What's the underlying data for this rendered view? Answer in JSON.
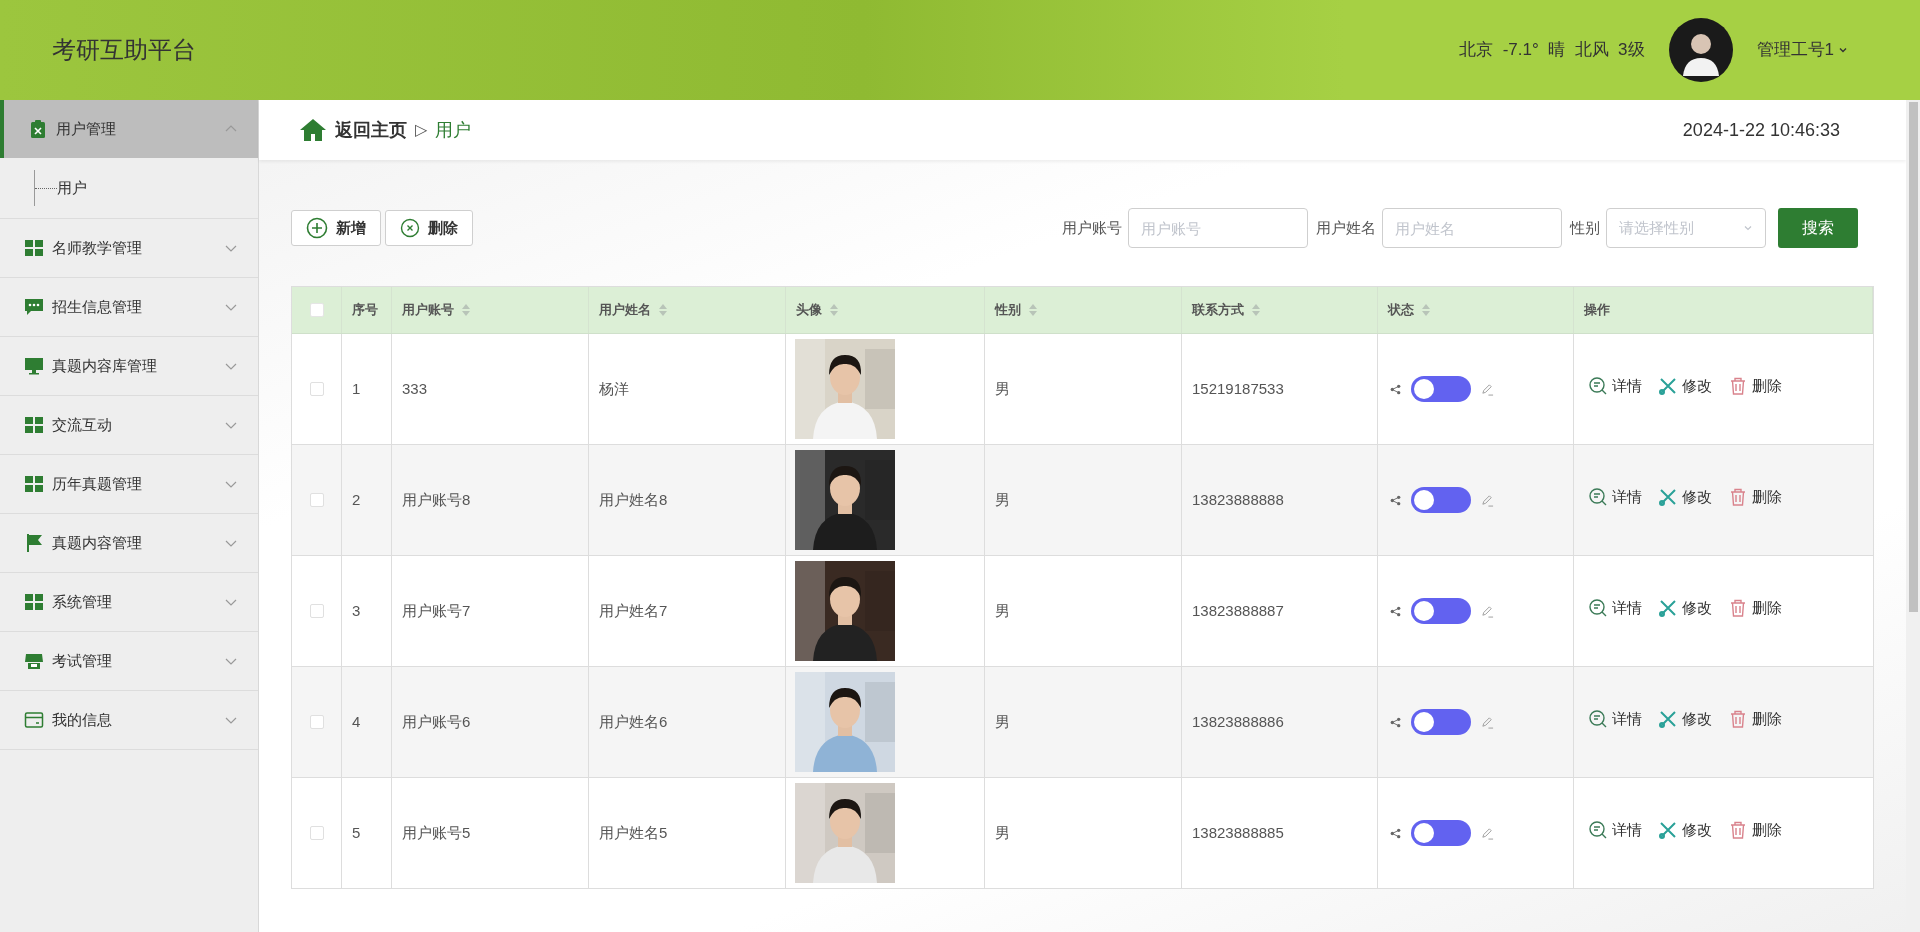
{
  "header": {
    "title": "考研互助平台",
    "weather": "北京  -7.1°  晴  北风  3级",
    "user": "管理工号1"
  },
  "sidebar": {
    "items": [
      {
        "label": "用户管理",
        "kind": "clipboard",
        "expanded": true,
        "selected": true,
        "children": [
          {
            "label": "用户"
          }
        ]
      },
      {
        "label": "名师教学管理",
        "kind": "grid",
        "expanded": false,
        "selected": false
      },
      {
        "label": "招生信息管理",
        "kind": "chat",
        "expanded": false,
        "selected": false
      },
      {
        "label": "真题内容库管理",
        "kind": "monitor",
        "expanded": false,
        "selected": false
      },
      {
        "label": "交流互动",
        "kind": "grid",
        "expanded": false,
        "selected": false
      },
      {
        "label": "历年真题管理",
        "kind": "grid",
        "expanded": false,
        "selected": false
      },
      {
        "label": "真题内容管理",
        "kind": "flag",
        "expanded": false,
        "selected": false
      },
      {
        "label": "系统管理",
        "kind": "grid",
        "expanded": false,
        "selected": false
      },
      {
        "label": "考试管理",
        "kind": "shop",
        "expanded": false,
        "selected": false
      },
      {
        "label": "我的信息",
        "kind": "card",
        "expanded": false,
        "selected": false
      }
    ]
  },
  "breadcrumb": {
    "home": "返回主页",
    "separator": "▷",
    "current": "用户"
  },
  "datetime": "2024-1-22 10:46:33",
  "toolbar": {
    "buttons": [
      {
        "label": "新增",
        "kind": "add"
      },
      {
        "label": "删除",
        "kind": "remove"
      }
    ],
    "filters": [
      {
        "label": "用户账号",
        "placeholder": "用户账号",
        "kind": "text"
      },
      {
        "label": "用户姓名",
        "placeholder": "用户姓名",
        "kind": "text"
      },
      {
        "label": "性别",
        "placeholder": "请选择性别",
        "kind": "select"
      }
    ],
    "search": "搜索"
  },
  "table": {
    "select_all_checked": false,
    "columns": [
      {
        "label": "序号",
        "sortable": false
      },
      {
        "label": "用户账号",
        "sortable": true
      },
      {
        "label": "用户姓名",
        "sortable": true
      },
      {
        "label": "头像",
        "sortable": true
      },
      {
        "label": "性别",
        "sortable": true
      },
      {
        "label": "联系方式",
        "sortable": true
      },
      {
        "label": "状态",
        "sortable": true
      },
      {
        "label": "操作",
        "sortable": false
      }
    ],
    "rows": [
      {
        "index": "1",
        "account": "333",
        "name": "杨洋",
        "gender": "男",
        "phone": "15219187533",
        "on": false,
        "checked": false,
        "actions": [
          "详情",
          "修改",
          "删除"
        ]
      },
      {
        "index": "2",
        "account": "用户账号8",
        "name": "用户姓名8",
        "gender": "男",
        "phone": "13823888888",
        "on": false,
        "checked": false,
        "actions": [
          "详情",
          "修改",
          "删除"
        ]
      },
      {
        "index": "3",
        "account": "用户账号7",
        "name": "用户姓名7",
        "gender": "男",
        "phone": "13823888887",
        "on": false,
        "checked": false,
        "actions": [
          "详情",
          "修改",
          "删除"
        ]
      },
      {
        "index": "4",
        "account": "用户账号6",
        "name": "用户姓名6",
        "gender": "男",
        "phone": "13823888886",
        "on": false,
        "checked": false,
        "actions": [
          "详情",
          "修改",
          "删除"
        ]
      },
      {
        "index": "5",
        "account": "用户账号5",
        "name": "用户姓名5",
        "gender": "男",
        "phone": "13823888885",
        "on": false,
        "checked": false,
        "actions": [
          "详情",
          "修改",
          "删除"
        ]
      }
    ]
  }
}
